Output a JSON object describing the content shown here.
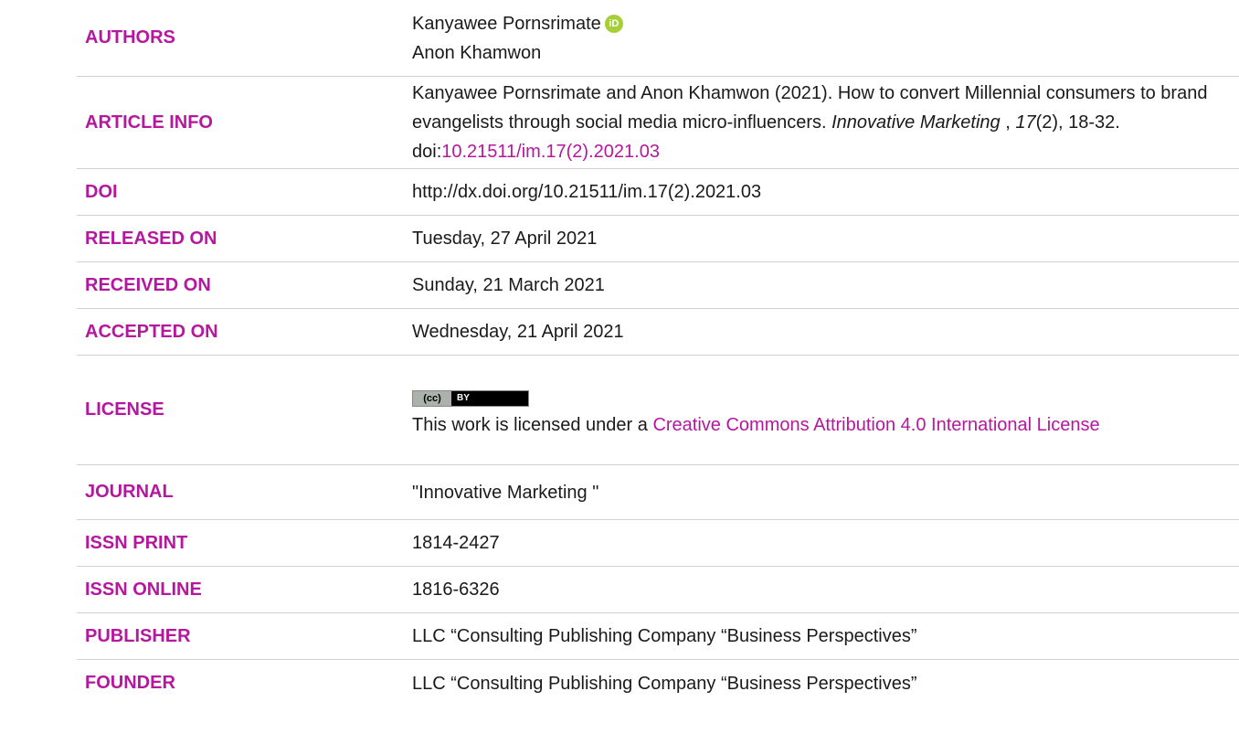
{
  "authors": {
    "label": "AUTHORS",
    "names": [
      "Kanyawee Pornsrimate",
      "Anon Khamwon"
    ],
    "orcid_glyph": "iD"
  },
  "article_info": {
    "label": "ARTICLE INFO",
    "citation_text": "Kanyawee Pornsrimate and Anon Khamwon (2021). How to convert Millennial consumers to brand evangelists through social media micro-influencers.",
    "journal_italic": "Innovative Marketing",
    "comma": " , ",
    "volume_italic": "17",
    "issue_pages": "(2), 18-32. doi:",
    "doi_link": "10.21511/im.17(2).2021.03"
  },
  "doi": {
    "label": "DOI",
    "value": "http://dx.doi.org/10.21511/im.17(2).2021.03"
  },
  "released": {
    "label": "RELEASED ON",
    "value": "Tuesday, 27 April 2021"
  },
  "received": {
    "label": "RECEIVED ON",
    "value": "Sunday, 21 March 2021"
  },
  "accepted": {
    "label": "ACCEPTED ON",
    "value": "Wednesday, 21 April 2021"
  },
  "license": {
    "label": "LICENSE",
    "badge_left": "(cc)",
    "badge_right": "BY",
    "prefix": "This work is licensed under a ",
    "link_text": "Creative Commons Attribution 4.0 International License"
  },
  "journal": {
    "label": "JOURNAL",
    "value": "\"Innovative Marketing \""
  },
  "issn_print": {
    "label": "ISSN PRINT",
    "value": "1814-2427"
  },
  "issn_online": {
    "label": "ISSN ONLINE",
    "value": "1816-6326"
  },
  "publisher": {
    "label": "PUBLISHER",
    "value": "LLC “Consulting Publishing Company “Business Perspectives”"
  },
  "founder": {
    "label": "FOUNDER",
    "value": "LLC “Consulting Publishing Company “Business Perspectives”"
  },
  "colors": {
    "label": "#b5179e",
    "orcid": "#a6ce39",
    "divider": "#d0d0d0"
  },
  "icons": {
    "orcid": "orcid-icon",
    "cc": "cc-by-badge-icon"
  }
}
